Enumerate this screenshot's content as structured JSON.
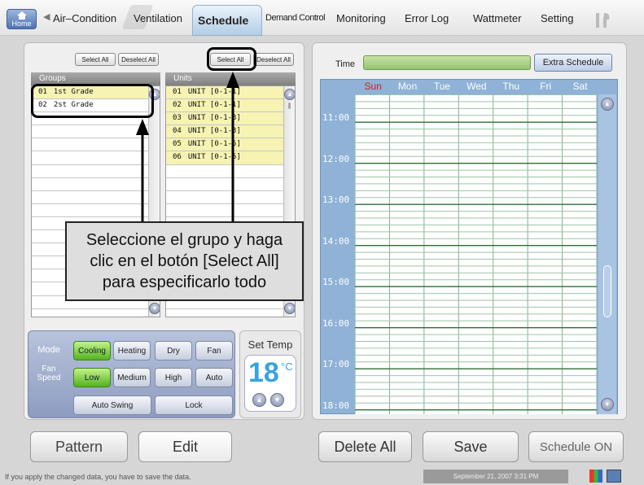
{
  "nav": {
    "home_label": "Home",
    "tabs": [
      "Air–Condition",
      "Ventilation",
      "Schedule",
      "Demand Control",
      "Monitoring",
      "Error Log",
      "Wattmeter",
      "Setting"
    ],
    "active_tab": "Schedule"
  },
  "groups": {
    "header": "Groups",
    "select_all": "Select All",
    "deselect_all": "Deselect All",
    "items": [
      {
        "no": "01",
        "name": "1st Grade"
      },
      {
        "no": "02",
        "name": "2st Grade"
      }
    ]
  },
  "units": {
    "header": "Units",
    "select_all": "Select All",
    "deselect_all": "Deselect All",
    "items": [
      {
        "no": "01",
        "name": "UNIT [0-1-1]"
      },
      {
        "no": "02",
        "name": "UNIT [0-1-1]"
      },
      {
        "no": "03",
        "name": "UNIT [0-1-3]"
      },
      {
        "no": "04",
        "name": "UNIT [0-1-3]"
      },
      {
        "no": "05",
        "name": "UNIT [0-1-5]"
      },
      {
        "no": "06",
        "name": "UNIT [0-1-5]"
      }
    ]
  },
  "callout_text": "Seleccione el grupo y haga\nclic en el botón [Select All]\npara especificarlo todo",
  "controls": {
    "mode_label": "Mode",
    "modes": [
      "Cooling",
      "Heating",
      "Dry",
      "Fan"
    ],
    "active_mode": "Cooling",
    "fan_label": "Fan Speed",
    "fan_speeds": [
      "Low",
      "Medium",
      "High",
      "Auto"
    ],
    "active_fan": "Low",
    "auto_swing": "Auto Swing",
    "lock": "Lock",
    "set_temp_label": "Set Temp",
    "set_temp_value": "18",
    "temp_unit": "°C"
  },
  "schedule": {
    "time_label": "Time",
    "extra_schedule": "Extra Schedule",
    "days": [
      "Sun",
      "Mon",
      "Tue",
      "Wed",
      "Thu",
      "Fri",
      "Sat"
    ],
    "times": [
      "11:00",
      "12:00",
      "13:00",
      "14:00",
      "15:00",
      "16:00",
      "17:00",
      "18:00"
    ],
    "colors": {
      "sunday": "#cc2020",
      "weekday": "#ffffff",
      "grid_bg": "#8fb2d6"
    }
  },
  "buttons": {
    "pattern": "Pattern",
    "edit": "Edit",
    "delete_all": "Delete All",
    "save": "Save",
    "schedule_on": "Schedule ON"
  },
  "status": {
    "message": "If you apply the changed data,  you have to save the data.",
    "datetime": "September 21, 2007 3:31 PM"
  }
}
